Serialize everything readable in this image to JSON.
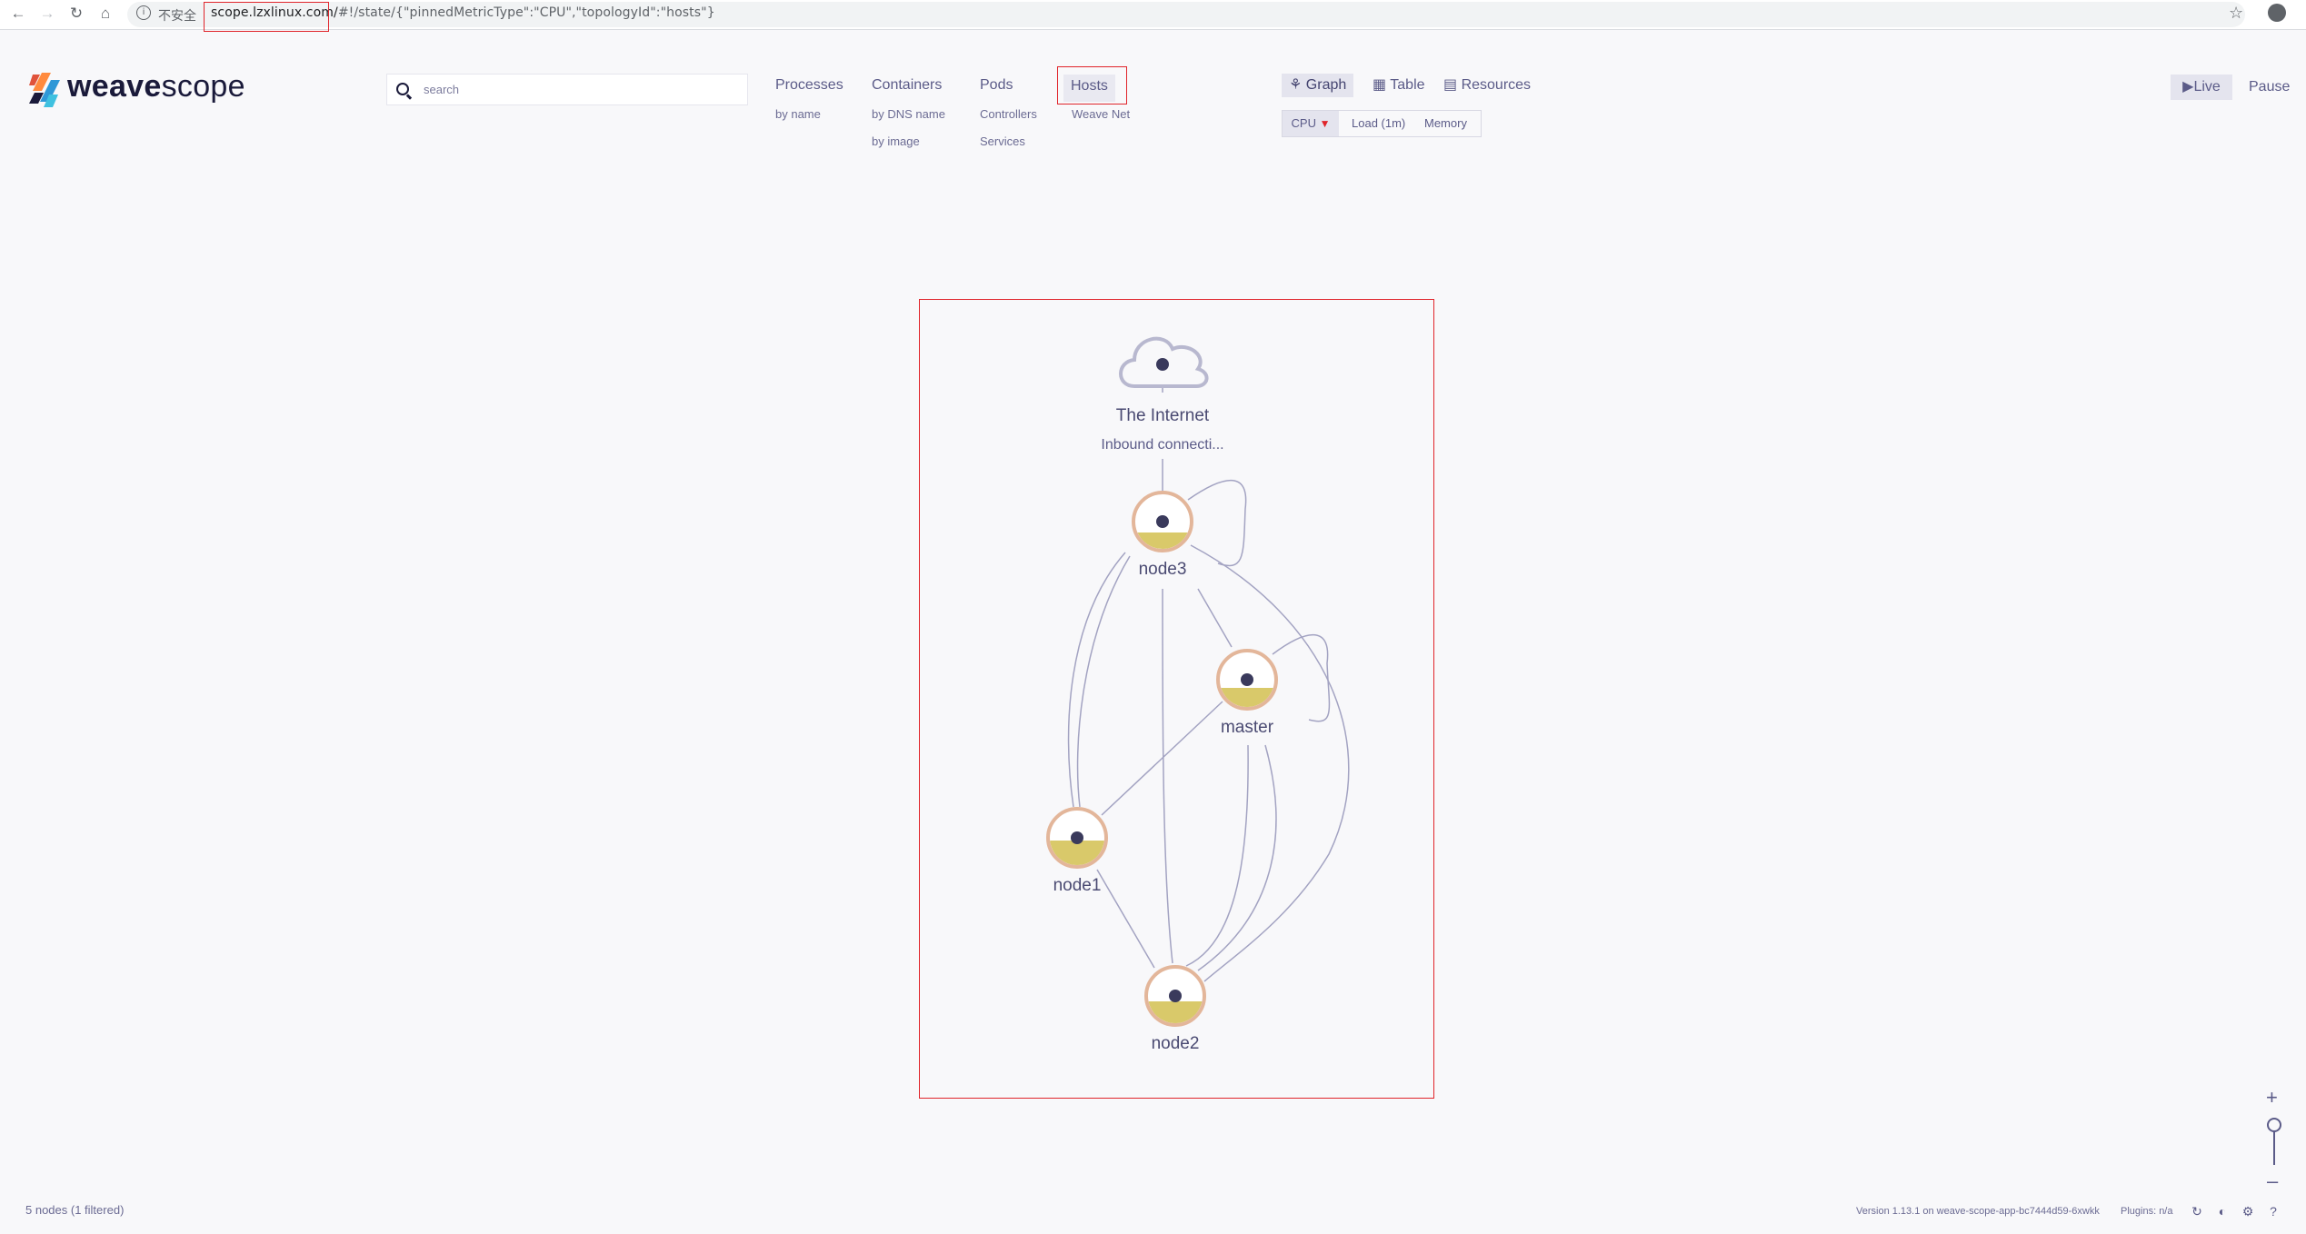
{
  "browser": {
    "insecure_label": "不安全",
    "url_host": "scope.lzxlinux.com/",
    "url_rest": "#!/state/{\"pinnedMetricType\":\"CPU\",\"topologyId\":\"hosts\"}"
  },
  "app": {
    "logo_light": "weave",
    "logo_bold": "scope",
    "search_placeholder": "search"
  },
  "topologies": [
    {
      "label": "Processes",
      "subs": [
        "by name"
      ]
    },
    {
      "label": "Containers",
      "subs": [
        "by DNS name",
        "by image"
      ]
    },
    {
      "label": "Pods",
      "subs": [
        "Controllers",
        "Services"
      ]
    },
    {
      "label": "Hosts",
      "subs": [
        "Weave Net"
      ],
      "selected": true
    }
  ],
  "views": [
    {
      "label": "Graph",
      "selected": true,
      "icon": "graph-icon"
    },
    {
      "label": "Table",
      "icon": "table-icon"
    },
    {
      "label": "Resources",
      "icon": "chart-icon"
    }
  ],
  "metrics": [
    {
      "label": "CPU",
      "selected": true,
      "pinned": true
    },
    {
      "label": "Load (1m)"
    },
    {
      "label": "Memory"
    }
  ],
  "controls": {
    "live": "Live",
    "pause": "Pause"
  },
  "graph": {
    "internet": {
      "label": "The Internet",
      "sublabel": "Inbound connecti..."
    },
    "nodes": [
      {
        "id": "node3",
        "label": "node3",
        "cpu_fill": 0.3
      },
      {
        "id": "master",
        "label": "master",
        "cpu_fill": 0.35
      },
      {
        "id": "node1",
        "label": "node1",
        "cpu_fill": 0.45
      },
      {
        "id": "node2",
        "label": "node2",
        "cpu_fill": 0.4
      }
    ],
    "colors": {
      "node_ring": "#e3b69a",
      "cpu_fill": "#d9c96a",
      "edge": "#a3a3c2",
      "label": "#4a4a72"
    }
  },
  "footer": {
    "status": "5 nodes (1 filtered)",
    "version": "Version 1.13.1 on weave-scope-app-bc7444d59-6xwkk",
    "plugins": "Plugins: n/a"
  }
}
